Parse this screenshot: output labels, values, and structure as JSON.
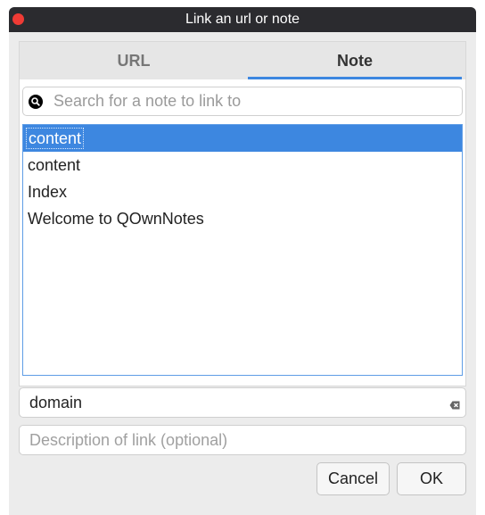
{
  "window": {
    "title": "Link an url or note"
  },
  "tabs": [
    {
      "label": "URL",
      "active": false
    },
    {
      "label": "Note",
      "active": true
    }
  ],
  "search": {
    "placeholder": "Search for a note to link to",
    "value": ""
  },
  "notes": {
    "items": [
      {
        "label": "content",
        "selected": true
      },
      {
        "label": "content",
        "selected": false
      },
      {
        "label": "Index",
        "selected": false
      },
      {
        "label": "Welcome to QOwnNotes",
        "selected": false
      }
    ]
  },
  "url_field": {
    "value": "domain"
  },
  "description_field": {
    "placeholder": "Description of link (optional)",
    "value": ""
  },
  "buttons": {
    "cancel": "Cancel",
    "ok": "OK"
  },
  "icons": {
    "close": "close-dot-icon",
    "search": "search-icon",
    "clear": "clear-text-icon"
  },
  "colors": {
    "accent": "#3d87e0",
    "titlebar": "#2b2b2f",
    "close": "#ef3b35"
  }
}
